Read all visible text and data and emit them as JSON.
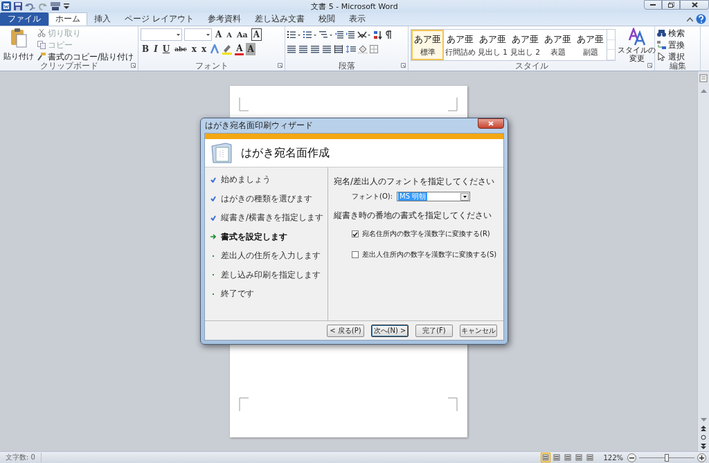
{
  "window": {
    "title": "文書 5 - Microsoft Word"
  },
  "ribbon_tabs": [
    {
      "label": "ファイル",
      "kind": "file",
      "selected": false
    },
    {
      "label": "ホーム",
      "kind": "tab",
      "selected": true
    },
    {
      "label": "挿入",
      "kind": "tab",
      "selected": false
    },
    {
      "label": "ページ レイアウト",
      "kind": "tab",
      "selected": false
    },
    {
      "label": "参考資料",
      "kind": "tab",
      "selected": false
    },
    {
      "label": "差し込み文書",
      "kind": "tab",
      "selected": false
    },
    {
      "label": "校閲",
      "kind": "tab",
      "selected": false
    },
    {
      "label": "表示",
      "kind": "tab",
      "selected": false
    }
  ],
  "clipboard": {
    "label": "クリップボード",
    "paste": "貼り付け",
    "items": [
      {
        "label": "切り取り",
        "disabled": true
      },
      {
        "label": "コピー",
        "disabled": true
      },
      {
        "label": "書式のコピー/貼り付け",
        "disabled": false
      }
    ]
  },
  "font_group": {
    "label": "フォント",
    "row_1": [
      "A",
      "A",
      "Aa",
      "A"
    ],
    "row_2": [
      "B",
      "I",
      "U",
      "abc",
      "x",
      "x",
      "A",
      "A"
    ]
  },
  "paragraph_group": {
    "label": "段落"
  },
  "styles": {
    "label": "スタイル",
    "items": [
      {
        "preview": "あア亜",
        "name": "標準",
        "selected": true
      },
      {
        "preview": "あア亜",
        "name": "行間詰め",
        "selected": false
      },
      {
        "preview": "あア亜",
        "name": "見出し 1",
        "selected": false
      },
      {
        "preview": "あア亜",
        "name": "見出し 2",
        "selected": false
      },
      {
        "preview": "あア亜",
        "name": "表題",
        "selected": false
      },
      {
        "preview": "あア亜",
        "name": "副題",
        "selected": false
      }
    ],
    "change_lines": [
      "スタイルの",
      "変更"
    ]
  },
  "editing": {
    "label": "編集",
    "items": [
      "検索",
      "置換",
      "選択"
    ]
  },
  "dialog": {
    "title": "はがき宛名面印刷ウィザード",
    "heading": "はがき宛名面作成",
    "steps": [
      {
        "label": "始めましょう",
        "completed": true,
        "selected": false
      },
      {
        "label": "はがきの種類を選びます",
        "completed": true,
        "selected": false
      },
      {
        "label": "縦書き/横書きを指定します",
        "completed": true,
        "selected": false
      },
      {
        "label": "書式を設定します",
        "completed": false,
        "selected": true
      },
      {
        "label": "差出人の住所を入力します",
        "completed": false,
        "selected": false
      },
      {
        "label": "差し込み印刷を指定します",
        "completed": false,
        "selected": false
      },
      {
        "label": "終了です",
        "completed": false,
        "selected": false
      }
    ],
    "font_prompt": "宛名/差出人のフォントを指定してください",
    "font_label": "フォント(O):",
    "font_value": "MS 明朝",
    "numerals_prompt": "縦書き時の番地の書式を指定してください",
    "checkboxes": [
      {
        "label": "宛名住所内の数字を漢数字に変換する(R)",
        "checked": true
      },
      {
        "label": "差出人住所内の数字を漢数字に変換する(S)",
        "checked": false
      }
    ],
    "buttons": [
      {
        "label": "< 戻る(P)",
        "default": false
      },
      {
        "label": "次へ(N) >",
        "default": true
      },
      {
        "label": "完了(F)",
        "default": false
      },
      {
        "label": "キャンセル",
        "default": false
      }
    ]
  },
  "status_bar": {
    "word_count": "文字数: 0",
    "view_buttons": [
      {
        "selected": true
      },
      {
        "selected": false
      },
      {
        "selected": false
      },
      {
        "selected": false
      },
      {
        "selected": false
      }
    ],
    "zoom": "122%",
    "zoom_slider": {
      "level": 0.5
    }
  }
}
